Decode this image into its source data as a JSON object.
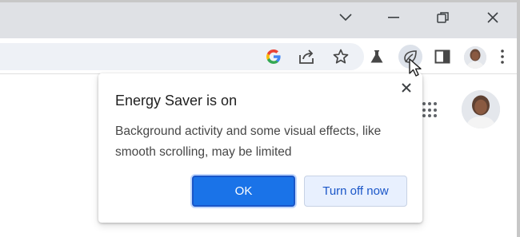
{
  "window": {
    "controls": [
      "chevron-down-icon",
      "minimize-icon",
      "restore-icon",
      "close-icon"
    ]
  },
  "toolbar": {
    "icons": [
      "google-icon",
      "share-icon",
      "bookmark-star-icon",
      "labs-flask-icon",
      "energy-saver-icon",
      "side-panel-icon",
      "profile-avatar",
      "more-menu-icon"
    ]
  },
  "bubble": {
    "title": "Energy Saver is on",
    "body": "Background activity and some visual effects, like smooth scrolling, may be limited",
    "ok_label": "OK",
    "turn_off_label": "Turn off now"
  },
  "colors": {
    "accent": "#1a73e8",
    "secondary_button_bg": "#e8f0fe",
    "titlebar": "#dfe1e5",
    "omnibox": "#eef1f6"
  }
}
